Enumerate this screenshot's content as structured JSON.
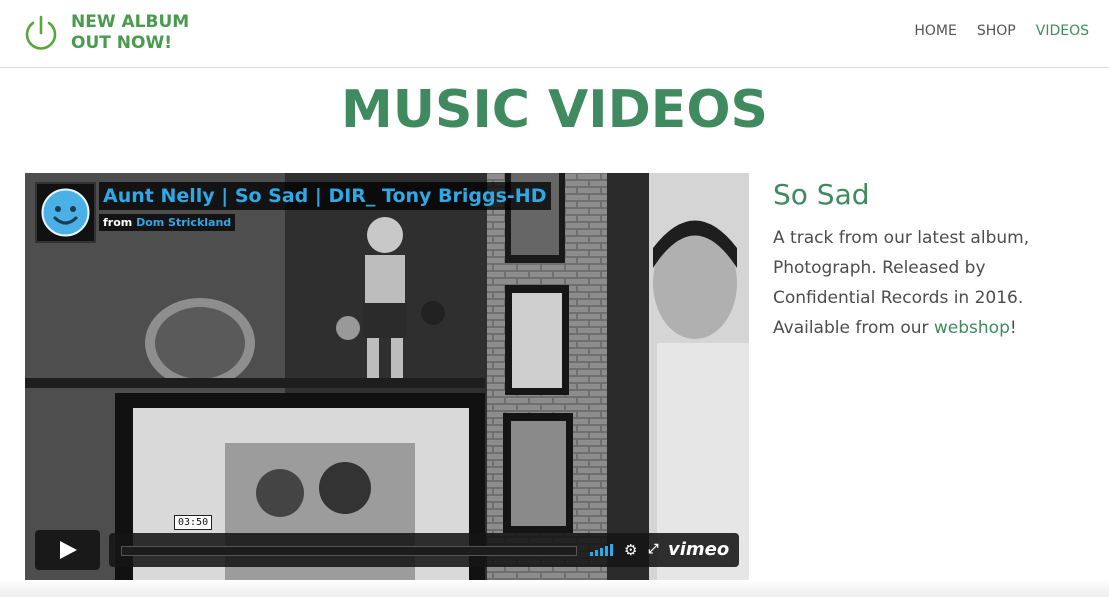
{
  "brand": {
    "line1": "NEW ALBUM",
    "line2": "OUT NOW!",
    "color": "#4a9a4e"
  },
  "nav": {
    "items": [
      {
        "label": "HOME"
      },
      {
        "label": "SHOP"
      },
      {
        "label": "VIDEOS",
        "active": true
      }
    ]
  },
  "page": {
    "title": "MUSIC VIDEOS",
    "accent": "#3f8a5f"
  },
  "video": {
    "title": "Aunt Nelly | So Sad | DIR_ Tony Briggs-HD",
    "from_label": "from",
    "author": "Dom Strickland",
    "duration": "03:50",
    "player": "vimeo",
    "link_color": "#2fa8e6"
  },
  "side": {
    "song_title": "So Sad",
    "desc_before": "A track from our latest album, Photograph. Released by Confidential Records in 2016. Available from our ",
    "link_text": "webshop",
    "desc_after": "!"
  }
}
